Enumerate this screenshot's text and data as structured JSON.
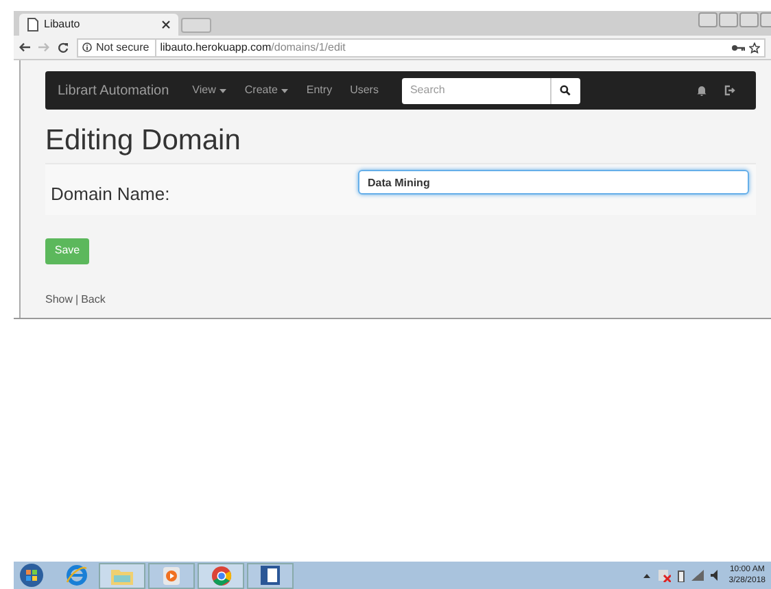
{
  "browser": {
    "tab_title": "Libauto",
    "security": "Not secure",
    "url_host": "libauto.herokuapp.com",
    "url_path": "/domains/1/edit"
  },
  "navbar": {
    "brand": "Librart Automation",
    "items": [
      {
        "label": "View",
        "dropdown": true
      },
      {
        "label": "Create",
        "dropdown": true
      },
      {
        "label": "Entry",
        "dropdown": false
      },
      {
        "label": "Users",
        "dropdown": false
      }
    ],
    "search_placeholder": "Search"
  },
  "heading": "Editing Domain",
  "form": {
    "label": "Domain Name:",
    "value": "Data Mining",
    "focused": true
  },
  "save_button": "Save",
  "links": [
    "Show",
    "Back"
  ],
  "link_separator": "|",
  "taskbar": {
    "time": "10:00 AM",
    "date": "3/28/2018"
  }
}
